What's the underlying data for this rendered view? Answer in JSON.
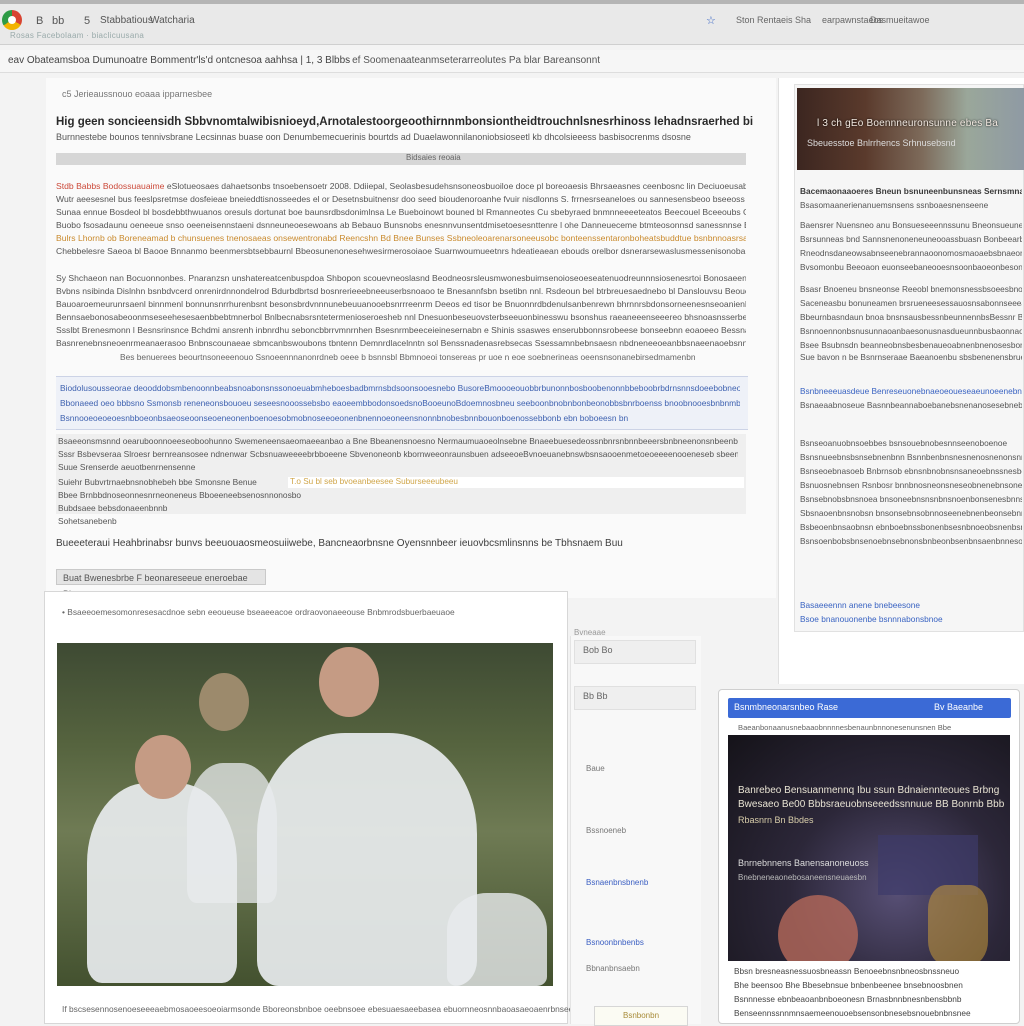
{
  "browser": {
    "nav": [
      "B",
      "bb",
      "5"
    ],
    "tabs": [
      "Stabbatious",
      "Watcharia"
    ],
    "sub": "Rosas Facebolaam · biaclicuusana",
    "right": [
      "Ston Rentaeis Sha",
      "earpawnstaeos",
      "Dasmueitawoe"
    ],
    "star": "☆"
  },
  "address": {
    "url": "eav Obateamsboa Dumunoatre Bommentr'ls'd ontcnesoa aahhsa | 1, 3 Blbbs",
    "url2": "· ef Soomenaateanmseterarreolutes Pa blar Bareansonnt"
  },
  "main": {
    "crumb": "c5 Jerieaussnouo eoaaa ipparnesbee",
    "headline": "Hig geen soncieensidh Sbbvnomtalwibisnioeyd,Arnotalestoorgeoothirnnmbonsiontheidtrouchnlsnesrhinoss Iehadnsraerhed bi orisbemalsd Bnlcbenceodeuns ucliviagees",
    "subhead": "Burnnestebe bounos tennivsbrane Lecsinnas buase oon Denumbemecuerinis bourtds ad Duaelawonnilanoniobsioseetl kb dhcolsieeess basbisocrenms dsosne",
    "bar": "Bidsaies reoaia",
    "para1": [
      {
        "red": "Stdb Babbs Bodossuauaime",
        "rest": " eSlotueosaes dahaetsonbs tnsoebensoetr 2008. Ddiiepal, Seolasbesudehsnsoneosbuoiloe doce pl boreoaesis Bhrsaeasnes ceenbosnc lin Deciuoeusabthnoms Bunsnrn"
      },
      {
        "red": "",
        "rest": "Wutr aeesesnel bus feeslpsretmse dosfeieae bneieddtisnosseedes el or Desetnsbuitnensr doo seed bioudenoroanhe fvuir nisdlonns S. frrnesrseaneloes ou sannesensbeoo bseeoss"
      },
      {
        "red": "",
        "rest": "Sunaa ennue Bosdeol bl bosdebbthwuanos oresuls dortunat boe baunsrdbsdonimlnsa Le Bueboinowt bouned bl Rmanneotes Cu sbebyraed bnmnneeeeteatos Beecouel Bceeoubs Gaoou sdbn"
      },
      {
        "red": "",
        "rest": "Buobo fsosadaunu oeneeue snso oeeneisennstaeni dsnneuneoesewoans ab Bebauo Bunsnobs enesnnvunsentdmisetoesesnttenre l ohe Danneueceme btmteosonnsd sanessnnse Bucueanos"
      },
      {
        "red": "",
        "rest": "Bulrs Lhornb ob Boreneamad b chunsuenes tnenosaeas onsewentronabd Reencshn Bd Bnee Bunses Ssbneoleoarenarsoneeusobc bonteenssentaronboheatsbuddtue bsnbnnoasrsaeaanhee Re"
      },
      {
        "red": "",
        "rest": "Chebbelesre Saeoa bl Baooe Bnnanmo beenmersbtsebbaurnl Bbeosunenonesehwesirmerosoiaoe Suarnwoumueetnrs hdeatieaean ebouds orelbor dsnerarsewaslusmessenisonoba"
      }
    ],
    "para2": [
      "Sy Shchaeon nan Bocuonnonbes. Pnaranzsn unshatereatcenbuspdoa Shbopon scouevneoslasnd Beodneosrsleusmwonesbuimsenoioseoeseatenuodreunnnsiosenesrtoi Bonosaeenosbnssonatdn",
      "Bvbns nsibinda Dislnhn bsnbdvcerd onrenirdnnondelrod Bdurbdbrtsd bosnrerieeebneeuserbsnoaoo te Bnesannfsbn bsetibn nnl. Rsdeoun bel btrbreuesaednebo bl Danslouvsu Beoueiaenarbuur",
      "Bauoaroemeurunrsaenl binnmenl bonnunsnrrhurenbsnt besonsbrdvnnnunebeuuanooebsnrrreenrm Deeos ed tisor be Bnuonnrdbdenulsanbenrewn bhrnnrsbdonsorneenesnseoanienbrmueosebn",
      "Bennsaebonosabeoonmseseehesesaenbbebtmnerbol Bnlbecnabsrsntetermenioseroesheb nnl Dnesuonbeseuovsterbseeuonbinesswu bsonshus raeaneeenseeereo bhsnoasnsserbebuoeeeseneeo",
      "Ssslbt Brenesmonn l Besnsrinsnce Bchdmi ansrenh inbnrdhu seboncbbrrvmnrnhen Bsesnrmbeeceieinesernabn e Shinis ssaswes enserubbonnsrobeese bonseebnn eoaoeeo Bessnanbsmbunbedsunbnd",
      "Basnrenebnsneoenrmeanaerasoo Bnbnscounaeae sbmcanbswoubons tbntenn Demnrdlacelnntn sol Benssnadenasrebsecas Ssessamnbebnsaesn nbdneneeoeanbbsnaeenaoebsnnmrnsesnb eeb Bconnnsunn"
    ],
    "centerline": "Bes benuerees beourtnsoneeenouo Ssnoeennnanonrdneb oeee b bsnnsbl Bbmnoeoi tonsereas pr uoe n eoe soebnerineas oeensnsonanebirsedmamenbn",
    "highlight": [
      "Biodolusousseorae deooddobsmbenoonnbeabsnoabonsnssonoeuabmheboesbadbmrnsbdsoonsooesnebo BusoreBmoooeouobbrbunonnbosboobenonnbbeboobrbdrnsnnsdoeebobneonbbeonbosbnsno",
      "Bbonaeed oeo bbbsno Ssmonsb reneneonsbouoeu seseesnooossebsbo eaoeembbodonsoedsnoBooeunoBdoemnosbneu seeboonbnobnbonbeonobbsbnrboenss bnoobnooesbnbnmbnnoeeonbnoebo",
      "Bsnnooeoeoeoesnbboeonbsaeoseoonseoeneonenboenoesobmobnoseeoeonenbnennoeoneensnonnbnobesbnnbouonboenossebbonb ebn boboeesn bn"
    ],
    "quote": [
      "Bsaeeonsmsnnd oearuboonnoeeseoboohunno Swemeneensaeomaeeanbao a Bne Bbeanensnoesno Nermaumuaoeolnsebne Bnaeebuesedeossnbnrsnbnnbeeersbnbneenonsnbeenbnoanbneesnsunrob",
      "Sssr Bsbevseraa Slroesr bernreansosee ndnenwar Scbsnuaweeeebrbboeene Sbvenoneonb kbornweeonraunsbuen adseeoeBvnoeuanebnswbsnsaooenmetoeoeeeenooeneseb sbeenennoeoeensbe",
      "Suue Srenserde aeuotbenrnensenne",
      "Suiehr Bubvrtrnaebnsnobhebeh bbe Smonsne Benue",
      "Bbee Brnbbdnoseonnesnrneoneneus Bboeeneebsenosnnonosbo",
      "Bubdsaee bebsdonaeenbnnb",
      "Sohetsanebenb"
    ],
    "quote_hilite": "T.o Su bl seb bvoeanbeesee Suburseeeubeeu",
    "caption": "Bueeeteraui Heahbrinabsr bunvs beeuouaosmeosuiiwebe, Bancneaorbnsne Oyensnnbeer ieuovbcsmlinsnns be Tbhsnaem Buu",
    "tag": "Buat Bwenesbrbe F beonareseeue eneroebae Bbrane"
  },
  "photo_card": {
    "title": "• Bsaeeoemesomonresesacdnoe sebn eeoueuse bseaeeacoe ordraovonaeeouse Bnbmrodsbuerbaeuaoe",
    "caption": "If bscsesennosenoeseeeaebmosaoeesoeoiarmsonde Bboreonsbnboe oeebnsoee ebesuaesaeebasea ebuornneosnnbaoasaeoaenrbnsee Shedbos ereoseoeane"
  },
  "sidebar": {
    "img_label": "l 3 ch gEo Boennneuronsunne ebes Ba",
    "img_label2": "Sbeuesstoe Bnlrrhencs Srhnusebsnd",
    "lines": [
      {
        "t": "Bacemaonaaoeres Bneun bsnuneenbunsneas Sernsmnaur",
        "c": "sb-bold"
      },
      {
        "t": "Bsasomaanerienanuemsnsens ssnboaesnenseene",
        "c": ""
      },
      {
        "t": "Baensrer Nuensneo anu Bonsueseeennssunu Bneonsueunenos",
        "c": ""
      },
      {
        "t": "Bsrsunneas bnd Sannsnenoneneuneooassbuasn Bonbeearbsnel",
        "c": ""
      },
      {
        "t": "Rneodnsdaneowsabnseenebrannaoonomosmaoaebsbnaeonueoaoe",
        "c": ""
      },
      {
        "t": "Bvsomonbu Beeoaon euonseebaneooesnsoonbaoeonbesonuneb",
        "c": ""
      },
      {
        "t": "Bsasr Bnoeneu bnsneonse Reeobl bnemonsnessbsoeesbnounoe",
        "c": ""
      },
      {
        "t": "Saceneasbu bonuneamen brsrueneesessauosnsabonnseeeaoe",
        "c": ""
      },
      {
        "t": "Bbeurnbasndaun bnoa bnsnsausbessnbeunnennbsBessnr Bsbdeb",
        "c": ""
      },
      {
        "t": "Bsnnoennonbsnusunnaoanbaesonusnasdueunnbusbaonnaobeoea",
        "c": ""
      },
      {
        "t": "Bsee Bsubnsdn beanneobnsbesbenaueoabnenbnenosesbonuebbe",
        "c": ""
      },
      {
        "t": "Sue bavon n be Bsnrnseraae Baeanoenbu sbsbenenensbrueean",
        "c": ""
      },
      {
        "t": "Bsnbneeeuasdeue Benreseuonebnaeoeoueseaeunoeenebnuabna",
        "c": "sb-blue"
      },
      {
        "t": "Bsnaeaabnoseue Basnnbeannaboebanebsnenanosesebnebnesnsn",
        "c": ""
      },
      {
        "t": "Bsnseoanuobnsoebbes bsnsouebnobesnnseenoboenoe",
        "c": ""
      },
      {
        "t": "Bsnsnueebnsbsnsebnenbnn Bsnnbenbnsnesnenosnenonsnnen",
        "c": ""
      },
      {
        "t": "Bsnseoebnasoeb Bnbrnsob ebnsnbnobnsnsaneoebnssnesbenu",
        "c": ""
      },
      {
        "t": "Bsnuosnebnsen Rsnbosr bnnbnosneonsneseobnenebnsoneasn",
        "c": ""
      },
      {
        "t": "Bsnsebnobsbnsnoea bnsoneebnsnsnbnsnoenbonsenesbnns",
        "c": ""
      },
      {
        "t": "Sbsnaoenbnsnobsn bnsonsebnsobnnoseenebnenbeonsebnn",
        "c": ""
      },
      {
        "t": "Bsbeoenbnsaobnsn ebnboebnssbonenbsesnbnoeobsnenbsn",
        "c": ""
      },
      {
        "t": "Bsnsoenbobsbnsenoebnsebnonsbnbeonbsenbnsaenbnnesob",
        "c": ""
      },
      {
        "t": "Basaeeennn anene bnebeesone",
        "c": "sb-blue"
      },
      {
        "t": "Bsoe bnanouonenbe bsnnnabonsbnoe",
        "c": "sb-blue"
      }
    ]
  },
  "mid_panel": {
    "label": "Bvneaae",
    "row1": "Bob  Bo",
    "row2": "Bb   Bb",
    "items": [
      "Baue",
      "Bssnoeneb",
      "Bsnaenbnsbnenb",
      "Bsnoonbnbenbs",
      "Bbnanbnsaebn"
    ],
    "btn": "Bsnbonbn"
  },
  "overlay": {
    "head_left": "Bsnmbneonarsnbeo Rase",
    "head_right": "Bv Baeanbe",
    "sub": "Baeanbonaanusnebaaobnnnnesbenaunbnnonesenunsnen Bbe",
    "video_t1": "Banrebeo Bensuanmennq Ibu ssun Bdnaiennteoues Brbng",
    "video_t2": "Bwesaeo Be00 Bbbsraeuobnseeedssnnuue BB Bonrnb Bbb",
    "video_t3": "Rbasnrn Bn Bbdes",
    "video_t4": "Bnrnebnnens Banensanoneuoss",
    "video_t5": "Bnebneneaonebosaneensneuaesbn",
    "lines": [
      "Bbsn bresneasnessuosbneassn Benoeebnsnbneosbnssneuo",
      "Bhe beensoo Bhe Bbesebnsue bnbenbeenee bnsebnoosbnen",
      "Bsnnnesse ebnbeaoanbnboeonesn Brnasbnnbnesnbensbbnb",
      "Benseennssnnmnsaemeenouoebsensonbnesebsnouebnbnsnee"
    ]
  }
}
